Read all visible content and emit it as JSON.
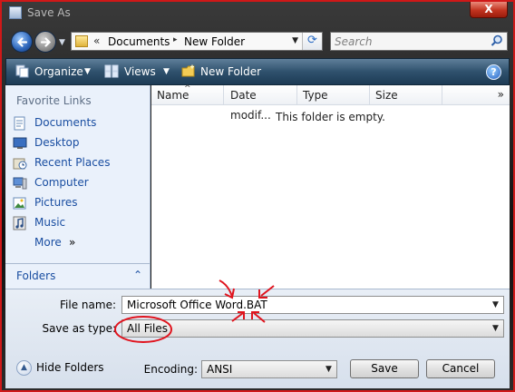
{
  "window": {
    "title": "Save As",
    "close_label": "X"
  },
  "address_bar": {
    "overflow": "«",
    "crumbs": [
      "Documents",
      "New Folder"
    ],
    "crumb_separator": "▸"
  },
  "search": {
    "placeholder": "Search"
  },
  "toolbar": {
    "organize": "Organize",
    "views": "Views",
    "new_folder": "New Folder",
    "help": "?"
  },
  "sidebar": {
    "section_title": "Favorite Links",
    "links": [
      {
        "label": "Documents",
        "icon": "documents-icon"
      },
      {
        "label": "Desktop",
        "icon": "desktop-icon"
      },
      {
        "label": "Recent Places",
        "icon": "recent-places-icon"
      },
      {
        "label": "Computer",
        "icon": "computer-icon"
      },
      {
        "label": "Pictures",
        "icon": "pictures-icon"
      },
      {
        "label": "Music",
        "icon": "music-icon"
      }
    ],
    "more": "More",
    "more_chevron": "»",
    "folders": "Folders"
  },
  "file_list": {
    "columns": [
      "Name",
      "Date modif...",
      "Type",
      "Size"
    ],
    "more_columns": "»",
    "empty_message": "This folder is empty."
  },
  "form": {
    "file_name_label": "File name:",
    "file_name_value": "Microsoft Office Word.BAT",
    "save_type_label": "Save as type:",
    "save_type_value": "All Files",
    "encoding_label": "Encoding:",
    "encoding_value": "ANSI"
  },
  "footer": {
    "hide_folders": "Hide Folders",
    "save": "Save",
    "cancel": "Cancel"
  },
  "colors": {
    "annotation": "#e0141e",
    "link": "#1a4ea1",
    "command_bar": "#2f516d"
  }
}
